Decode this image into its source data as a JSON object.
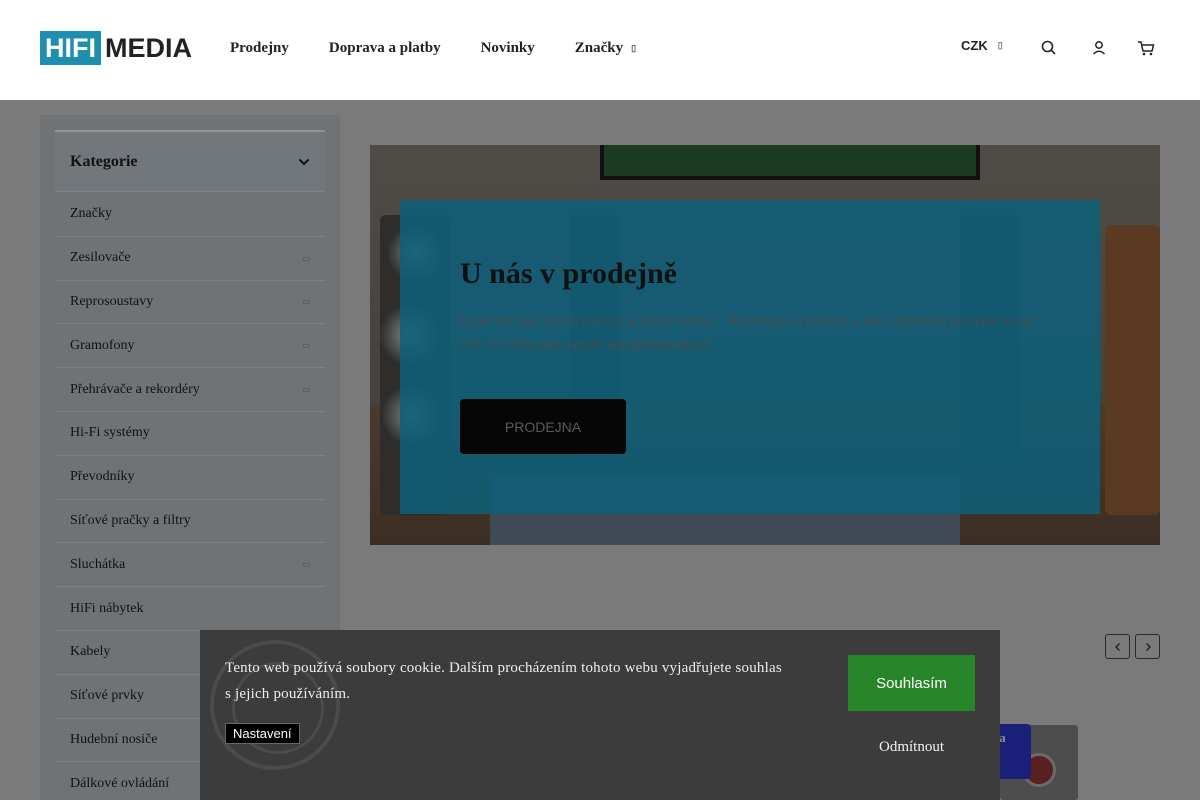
{
  "header": {
    "logo": {
      "part1": "HIFI",
      "part2": "MEDIA"
    },
    "nav": [
      {
        "label": "Prodejny"
      },
      {
        "label": "Doprava a platby"
      },
      {
        "label": "Novinky"
      },
      {
        "label": "Značky"
      }
    ],
    "currency": "CZK",
    "icons": [
      "search-icon",
      "user-icon",
      "cart-icon"
    ]
  },
  "sidebar": {
    "title": "Kategorie",
    "items": [
      {
        "label": "Značky",
        "expandable": false
      },
      {
        "label": "Zesilovače",
        "expandable": true
      },
      {
        "label": "Reprosoustavy",
        "expandable": true
      },
      {
        "label": "Gramofony",
        "expandable": true
      },
      {
        "label": "Přehrávače a rekordéry",
        "expandable": true
      },
      {
        "label": "Hi-Fi systémy",
        "expandable": false
      },
      {
        "label": "Převodníky",
        "expandable": false
      },
      {
        "label": "Síťové pračky a filtry",
        "expandable": false
      },
      {
        "label": "Sluchátka",
        "expandable": true
      },
      {
        "label": "HiFi nábytek",
        "expandable": false
      },
      {
        "label": "Kabely",
        "expandable": false
      },
      {
        "label": "Síťové prvky",
        "expandable": false
      },
      {
        "label": "Hudební nosiče",
        "expandable": false
      },
      {
        "label": "Dálkové ovládání",
        "expandable": false
      }
    ]
  },
  "hero": {
    "title": "U nás v prodejně",
    "text": "Lepší než tisíc cizích názorů, je názor vlastní… Rezervujte si poslech u nás v brněnské prodejně na tel: 733 777 228, nebo email: info@hifimedia.cz.",
    "button": "PRODEJNA"
  },
  "product_badge": "na\ny",
  "cookie": {
    "text": "Tento web používá soubory cookie. Dalším procházením tohoto webu vyjadřujete souhlas s jejich používáním.",
    "settings": "Nastavení",
    "accept": "Souhlasím",
    "decline": "Odmítnout"
  },
  "colors": {
    "brand": "#1f8fb0",
    "accept": "#27852a",
    "overlay": "#0f5f78"
  }
}
